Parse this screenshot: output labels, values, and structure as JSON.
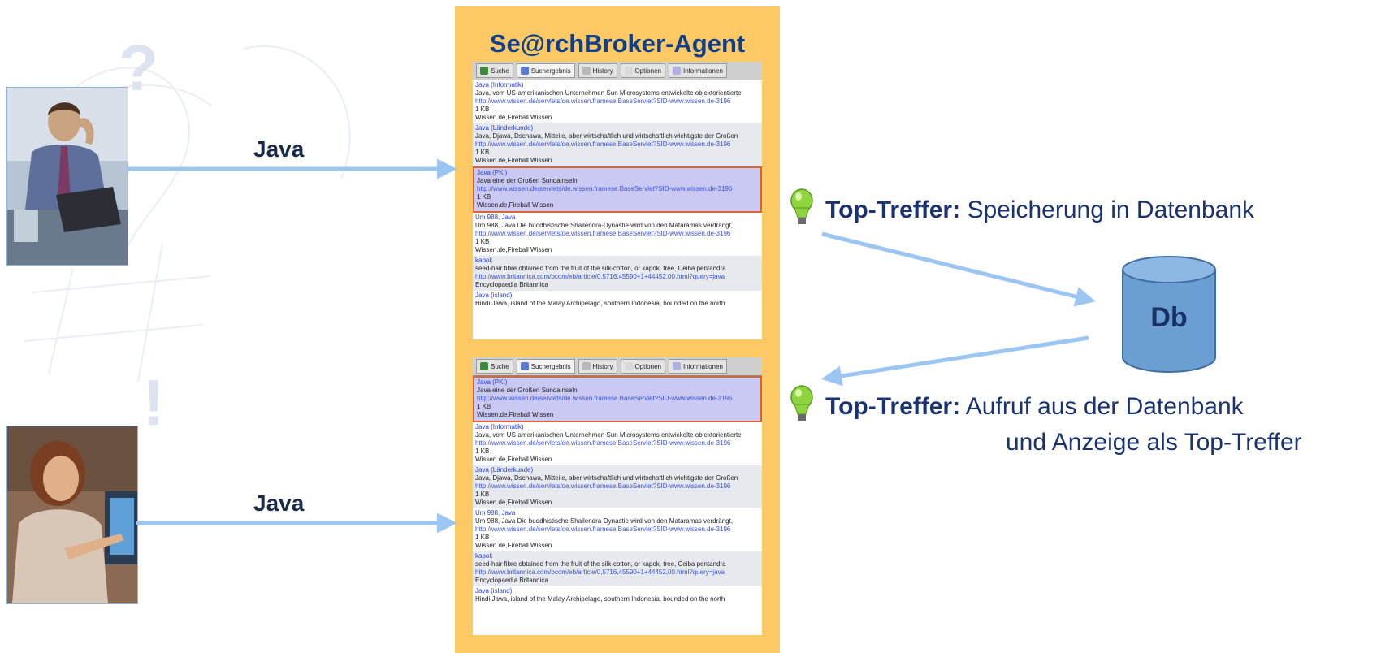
{
  "agent": {
    "title": "Se@rchBroker-Agent"
  },
  "query_labels": {
    "top": "Java",
    "bottom": "Java"
  },
  "decor": {
    "question_mark": "?",
    "exclamation_mark": "!"
  },
  "tabs": [
    {
      "label": "Suche",
      "icon": "search-icon"
    },
    {
      "label": "Suchergebnis",
      "icon": "results-icon"
    },
    {
      "label": "History",
      "icon": "history-icon"
    },
    {
      "label": "Optionen",
      "icon": "options-icon"
    },
    {
      "label": "Informationen",
      "icon": "info-icon"
    }
  ],
  "screen_top": {
    "results": [
      {
        "title": "Java (Informatik)",
        "desc": "Java, vom US-amerikanischen Unternehmen Sun Microsystems entwickelte objektorientierte",
        "url": "http://www.wissen.de/servlets/de.wissen.framese.BaseServlet?SID-www.wissen.de-3196",
        "size": "1 KB",
        "src": "Wissen.de,Fireball Wissen",
        "style": "plain"
      },
      {
        "title": "Java (Länderkunde)",
        "desc": "Java, Djawa, Dschawa, Mitteile, aber wirtschaftlich und wirtschaftlich wichtigste der Großen",
        "url": "http://www.wissen.de/servlets/de.wissen.framese.BaseServlet?SID-www.wissen.de-3196",
        "size": "1 KB",
        "src": "Wissen.de,Fireball Wissen",
        "style": "alt"
      },
      {
        "title": "Java (PKI)",
        "desc": "Java eine der Großen Sundainseln",
        "url": "http://www.wissen.de/servlets/de.wissen.framese.BaseServlet?SID-www.wissen.de-3196",
        "size": "1 KB",
        "src": "Wissen.de,Fireball Wissen",
        "style": "hl"
      },
      {
        "title": "Um 988, Java",
        "desc": "Um 988, Java Die buddhistische Shailendra-Dynastie wird von den Mataramas verdrängt,",
        "url": "http://www.wissen.de/servlets/de.wissen.framese.BaseServlet?SID-www.wissen.de-3196",
        "size": "1 KB",
        "src": "Wissen.de,Fireball Wissen",
        "style": "plain"
      },
      {
        "title": "kapok",
        "desc": "seed-hair fibre obtained from the fruit of the silk-cotton, or kapok, tree, Ceiba pentandra",
        "url": "http://www.britannica.com/bcom/eb/article/0,5716,45590+1+44452,00.html?query=java",
        "size": "",
        "src": "Encyclopaedia Britannica",
        "style": "alt"
      },
      {
        "title": "Java (island)",
        "desc": "Hindi Jawa, island of the Malay Archipelago, southern Indonesia, bounded on the north",
        "url": "",
        "size": "",
        "src": "",
        "style": "plain"
      }
    ]
  },
  "screen_bottom": {
    "results": [
      {
        "title": "Java (PKI)",
        "desc": "Java eine der Großen Sundainseln",
        "url": "http://www.wissen.de/servlets/de.wissen.framese.BaseServlet?SID-www.wissen.de-3196",
        "size": "1 KB",
        "src": "Wissen.de,Fireball Wissen",
        "style": "hl"
      },
      {
        "title": "Java (Informatik)",
        "desc": "Java, vom US-amerikanischen Unternehmen Sun Microsystems entwickelte objektorientierte",
        "url": "http://www.wissen.de/servlets/de.wissen.framese.BaseServlet?SID-www.wissen.de-3196",
        "size": "1 KB",
        "src": "Wissen.de,Fireball Wissen",
        "style": "plain"
      },
      {
        "title": "Java (Länderkunde)",
        "desc": "Java, Djawa, Dschawa, Mitteile, aber wirtschaftlich und wirtschaftlich wichtigste der Großen",
        "url": "http://www.wissen.de/servlets/de.wissen.framese.BaseServlet?SID-www.wissen.de-3196",
        "size": "1 KB",
        "src": "Wissen.de,Fireball Wissen",
        "style": "alt"
      },
      {
        "title": "Um 988, Java",
        "desc": "Um 988, Java Die buddhistische Shailendra-Dynastie wird von den Mataramas verdrängt,",
        "url": "http://www.wissen.de/servlets/de.wissen.framese.BaseServlet?SID-www.wissen.de-3196",
        "size": "1 KB",
        "src": "Wissen.de,Fireball Wissen",
        "style": "plain"
      },
      {
        "title": "kapok",
        "desc": "seed-hair fibre obtained from the fruit of the silk-cotton, or kapok, tree, Ceiba pentandra",
        "url": "http://www.britannica.com/bcom/eb/article/0,5716,45590+1+44452,00.html?query=java",
        "size": "",
        "src": "Encyclopaedia Britannica",
        "style": "alt"
      },
      {
        "title": "Java (island)",
        "desc": "Hindi Jawa, island of the Malay Archipelago, southern Indonesia, bounded on the north",
        "url": "",
        "size": "",
        "src": "",
        "style": "plain"
      }
    ]
  },
  "top_treffer_1": {
    "bold": "Top-Treffer:",
    "text": "Speicherung in Datenbank"
  },
  "top_treffer_2": {
    "bold": "Top-Treffer:",
    "line1": "Aufruf aus der Datenbank",
    "line2": "und Anzeige als Top-Treffer"
  },
  "database": {
    "label": "Db"
  },
  "colors": {
    "panel": "#fdc964",
    "title": "#0f3e8a",
    "arrow": "#9cc6f2",
    "highlight_border": "#e0622c",
    "highlight_fill": "#c9c9f3",
    "bulb": "#7ec83a",
    "db": "#6b9ed3"
  }
}
